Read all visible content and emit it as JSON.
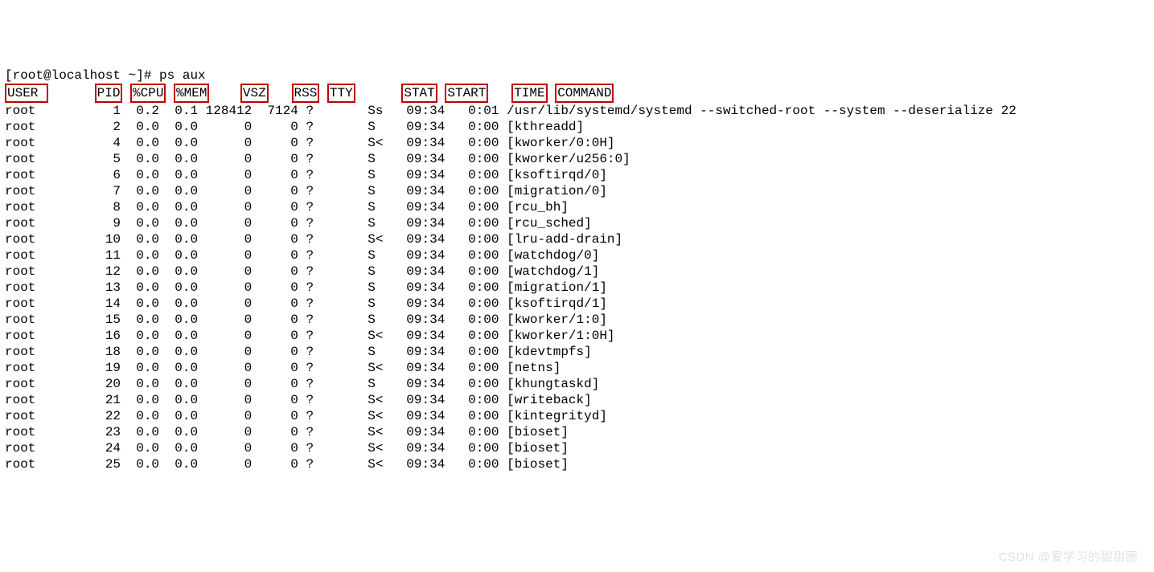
{
  "prompt": "[root@localhost ~]# ps aux",
  "headers": {
    "user": "USER",
    "pid": "PID",
    "cpu": "%CPU",
    "mem": "%MEM",
    "vsz": "VSZ",
    "rss": "RSS",
    "tty": "TTY",
    "stat": "STAT",
    "start": "START",
    "time": "TIME",
    "command": "COMMAND"
  },
  "rows": [
    {
      "user": "root",
      "pid": "1",
      "cpu": "0.2",
      "mem": "0.1",
      "vsz": "128412",
      "rss": "7124",
      "tty": "?",
      "stat": "Ss",
      "start": "09:34",
      "time": "0:01",
      "command": "/usr/lib/systemd/systemd --switched-root --system --deserialize 22"
    },
    {
      "user": "root",
      "pid": "2",
      "cpu": "0.0",
      "mem": "0.0",
      "vsz": "0",
      "rss": "0",
      "tty": "?",
      "stat": "S",
      "start": "09:34",
      "time": "0:00",
      "command": "[kthreadd]"
    },
    {
      "user": "root",
      "pid": "4",
      "cpu": "0.0",
      "mem": "0.0",
      "vsz": "0",
      "rss": "0",
      "tty": "?",
      "stat": "S<",
      "start": "09:34",
      "time": "0:00",
      "command": "[kworker/0:0H]"
    },
    {
      "user": "root",
      "pid": "5",
      "cpu": "0.0",
      "mem": "0.0",
      "vsz": "0",
      "rss": "0",
      "tty": "?",
      "stat": "S",
      "start": "09:34",
      "time": "0:00",
      "command": "[kworker/u256:0]"
    },
    {
      "user": "root",
      "pid": "6",
      "cpu": "0.0",
      "mem": "0.0",
      "vsz": "0",
      "rss": "0",
      "tty": "?",
      "stat": "S",
      "start": "09:34",
      "time": "0:00",
      "command": "[ksoftirqd/0]"
    },
    {
      "user": "root",
      "pid": "7",
      "cpu": "0.0",
      "mem": "0.0",
      "vsz": "0",
      "rss": "0",
      "tty": "?",
      "stat": "S",
      "start": "09:34",
      "time": "0:00",
      "command": "[migration/0]"
    },
    {
      "user": "root",
      "pid": "8",
      "cpu": "0.0",
      "mem": "0.0",
      "vsz": "0",
      "rss": "0",
      "tty": "?",
      "stat": "S",
      "start": "09:34",
      "time": "0:00",
      "command": "[rcu_bh]"
    },
    {
      "user": "root",
      "pid": "9",
      "cpu": "0.0",
      "mem": "0.0",
      "vsz": "0",
      "rss": "0",
      "tty": "?",
      "stat": "S",
      "start": "09:34",
      "time": "0:00",
      "command": "[rcu_sched]"
    },
    {
      "user": "root",
      "pid": "10",
      "cpu": "0.0",
      "mem": "0.0",
      "vsz": "0",
      "rss": "0",
      "tty": "?",
      "stat": "S<",
      "start": "09:34",
      "time": "0:00",
      "command": "[lru-add-drain]"
    },
    {
      "user": "root",
      "pid": "11",
      "cpu": "0.0",
      "mem": "0.0",
      "vsz": "0",
      "rss": "0",
      "tty": "?",
      "stat": "S",
      "start": "09:34",
      "time": "0:00",
      "command": "[watchdog/0]"
    },
    {
      "user": "root",
      "pid": "12",
      "cpu": "0.0",
      "mem": "0.0",
      "vsz": "0",
      "rss": "0",
      "tty": "?",
      "stat": "S",
      "start": "09:34",
      "time": "0:00",
      "command": "[watchdog/1]"
    },
    {
      "user": "root",
      "pid": "13",
      "cpu": "0.0",
      "mem": "0.0",
      "vsz": "0",
      "rss": "0",
      "tty": "?",
      "stat": "S",
      "start": "09:34",
      "time": "0:00",
      "command": "[migration/1]"
    },
    {
      "user": "root",
      "pid": "14",
      "cpu": "0.0",
      "mem": "0.0",
      "vsz": "0",
      "rss": "0",
      "tty": "?",
      "stat": "S",
      "start": "09:34",
      "time": "0:00",
      "command": "[ksoftirqd/1]"
    },
    {
      "user": "root",
      "pid": "15",
      "cpu": "0.0",
      "mem": "0.0",
      "vsz": "0",
      "rss": "0",
      "tty": "?",
      "stat": "S",
      "start": "09:34",
      "time": "0:00",
      "command": "[kworker/1:0]"
    },
    {
      "user": "root",
      "pid": "16",
      "cpu": "0.0",
      "mem": "0.0",
      "vsz": "0",
      "rss": "0",
      "tty": "?",
      "stat": "S<",
      "start": "09:34",
      "time": "0:00",
      "command": "[kworker/1:0H]"
    },
    {
      "user": "root",
      "pid": "18",
      "cpu": "0.0",
      "mem": "0.0",
      "vsz": "0",
      "rss": "0",
      "tty": "?",
      "stat": "S",
      "start": "09:34",
      "time": "0:00",
      "command": "[kdevtmpfs]"
    },
    {
      "user": "root",
      "pid": "19",
      "cpu": "0.0",
      "mem": "0.0",
      "vsz": "0",
      "rss": "0",
      "tty": "?",
      "stat": "S<",
      "start": "09:34",
      "time": "0:00",
      "command": "[netns]"
    },
    {
      "user": "root",
      "pid": "20",
      "cpu": "0.0",
      "mem": "0.0",
      "vsz": "0",
      "rss": "0",
      "tty": "?",
      "stat": "S",
      "start": "09:34",
      "time": "0:00",
      "command": "[khungtaskd]"
    },
    {
      "user": "root",
      "pid": "21",
      "cpu": "0.0",
      "mem": "0.0",
      "vsz": "0",
      "rss": "0",
      "tty": "?",
      "stat": "S<",
      "start": "09:34",
      "time": "0:00",
      "command": "[writeback]"
    },
    {
      "user": "root",
      "pid": "22",
      "cpu": "0.0",
      "mem": "0.0",
      "vsz": "0",
      "rss": "0",
      "tty": "?",
      "stat": "S<",
      "start": "09:34",
      "time": "0:00",
      "command": "[kintegrityd]"
    },
    {
      "user": "root",
      "pid": "23",
      "cpu": "0.0",
      "mem": "0.0",
      "vsz": "0",
      "rss": "0",
      "tty": "?",
      "stat": "S<",
      "start": "09:34",
      "time": "0:00",
      "command": "[bioset]"
    },
    {
      "user": "root",
      "pid": "24",
      "cpu": "0.0",
      "mem": "0.0",
      "vsz": "0",
      "rss": "0",
      "tty": "?",
      "stat": "S<",
      "start": "09:34",
      "time": "0:00",
      "command": "[bioset]"
    },
    {
      "user": "root",
      "pid": "25",
      "cpu": "0.0",
      "mem": "0.0",
      "vsz": "0",
      "rss": "0",
      "tty": "?",
      "stat": "S<",
      "start": "09:34",
      "time": "0:00",
      "command": "[bioset]"
    }
  ],
  "watermark": "CSDN @爱学习的甜甜圈"
}
